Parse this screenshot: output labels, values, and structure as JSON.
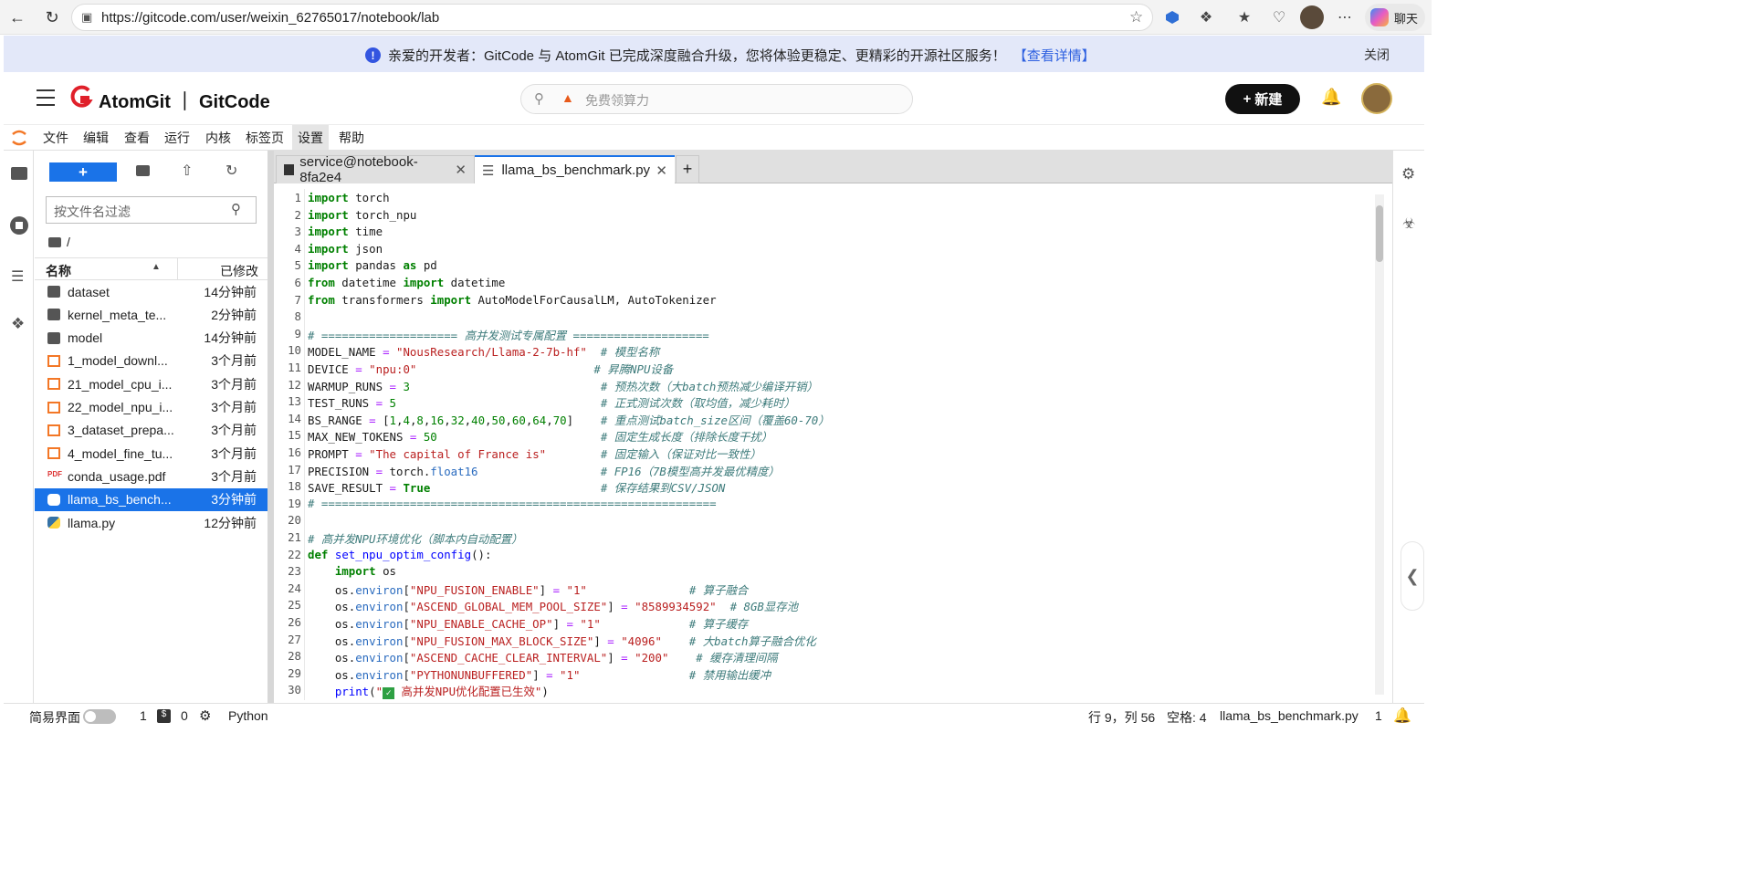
{
  "browser": {
    "url": "https://gitcode.com/user/weixin_62765017/notebook/lab",
    "chat_label": "聊天"
  },
  "banner": {
    "text": "亲爱的开发者：GitCode 与 AtomGit 已完成深度融合升级，您将体验更稳定、更精彩的开源社区服务！",
    "link": "【查看详情】",
    "close": "关闭"
  },
  "header": {
    "brand": "AtomGit ｜ GitCode",
    "search_placeholder": "免费领算力",
    "new_button": "新建"
  },
  "menu": [
    "文件",
    "编辑",
    "查看",
    "运行",
    "内核",
    "标签页",
    "设置",
    "帮助"
  ],
  "filebrowser": {
    "new_label": "+",
    "filter_placeholder": "按文件名过滤",
    "path": "/",
    "col_name": "名称",
    "col_modified": "已修改",
    "files": [
      {
        "name": "dataset",
        "modified": "14分钟前",
        "type": "folder"
      },
      {
        "name": "kernel_meta_te...",
        "modified": "2分钟前",
        "type": "folder"
      },
      {
        "name": "model",
        "modified": "14分钟前",
        "type": "folder"
      },
      {
        "name": "1_model_downl...",
        "modified": "3个月前",
        "type": "notebook"
      },
      {
        "name": "21_model_cpu_i...",
        "modified": "3个月前",
        "type": "notebook"
      },
      {
        "name": "22_model_npu_i...",
        "modified": "3个月前",
        "type": "notebook"
      },
      {
        "name": "3_dataset_prepa...",
        "modified": "3个月前",
        "type": "notebook"
      },
      {
        "name": "4_model_fine_tu...",
        "modified": "3个月前",
        "type": "notebook"
      },
      {
        "name": "conda_usage.pdf",
        "modified": "3个月前",
        "type": "pdf"
      },
      {
        "name": "llama_bs_bench...",
        "modified": "3分钟前",
        "type": "python"
      },
      {
        "name": "llama.py",
        "modified": "12分钟前",
        "type": "python"
      }
    ]
  },
  "tabs": [
    {
      "label": "service@notebook-8fa2e4"
    },
    {
      "label": "llama_bs_benchmark.py"
    }
  ],
  "code_lines": [
    "1",
    "2",
    "3",
    "4",
    "5",
    "6",
    "7",
    "8",
    "9",
    "10",
    "11",
    "12",
    "13",
    "14",
    "15",
    "16",
    "17",
    "18",
    "19",
    "20",
    "21",
    "22",
    "23",
    "24",
    "25",
    "26",
    "27",
    "28",
    "29",
    "30"
  ],
  "statusbar": {
    "simple_mode": "简易界面",
    "count1": "1",
    "count2": "0",
    "kernel": "Python",
    "position": "行 9，列 56",
    "spaces": "空格: 4",
    "filename": "llama_bs_benchmark.py",
    "notifications": "1"
  },
  "colors": {
    "banner_bg": "#e3e8f9",
    "accent": "#1a73e8",
    "notebook_icon": "#f37726"
  }
}
